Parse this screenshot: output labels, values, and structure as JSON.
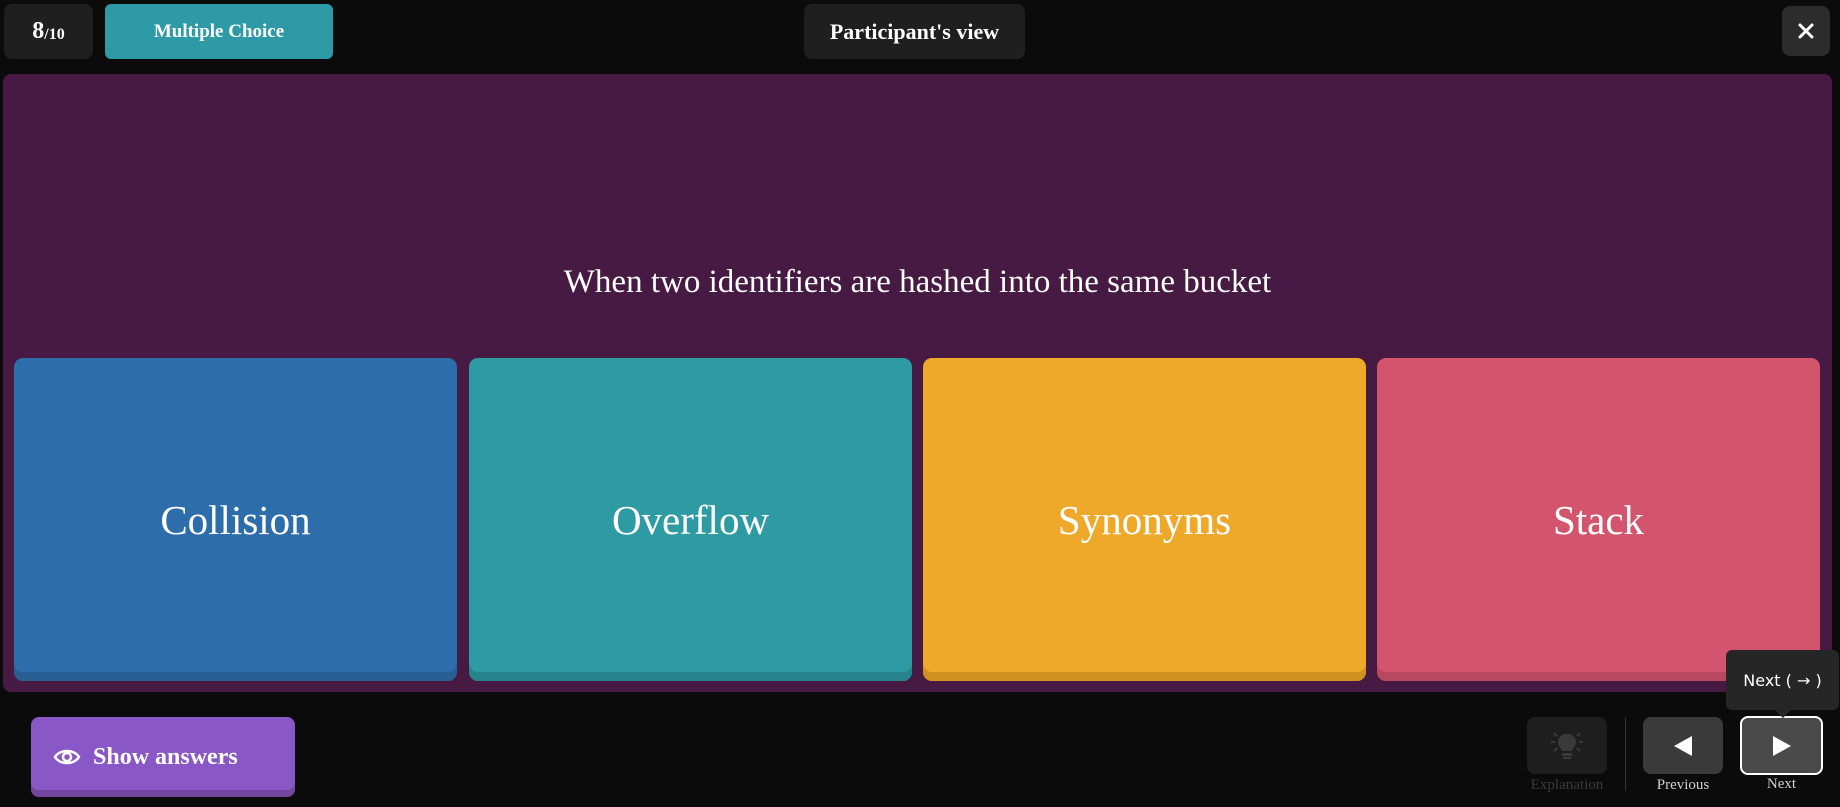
{
  "header": {
    "counter_current": "8",
    "counter_total": "/10",
    "question_type": "Multiple Choice",
    "view_label": "Participant's view",
    "close_icon": "close-icon"
  },
  "question": {
    "text": "When two identifiers are hashed into the same bucket"
  },
  "answers": [
    {
      "label": "Collision",
      "color": "#2d6dab"
    },
    {
      "label": "Overflow",
      "color": "#2e9aa4"
    },
    {
      "label": "Synonyms",
      "color": "#eea82a"
    },
    {
      "label": "Stack",
      "color": "#d3546d"
    }
  ],
  "footer": {
    "show_answers_label": "Show answers",
    "show_answers_icon": "eye-icon",
    "explanation_label": "Explanation",
    "explanation_icon": "lightbulb-icon",
    "previous_label": "Previous",
    "previous_icon": "triangle-left-icon",
    "next_label": "Next",
    "next_icon": "triangle-right-icon",
    "next_tooltip": "Next ( → )"
  },
  "colors": {
    "background": "#0b0b0b",
    "question_panel": "#461a42",
    "type_badge": "#2e9aa6",
    "show_answers_button": "#8a58c6"
  }
}
